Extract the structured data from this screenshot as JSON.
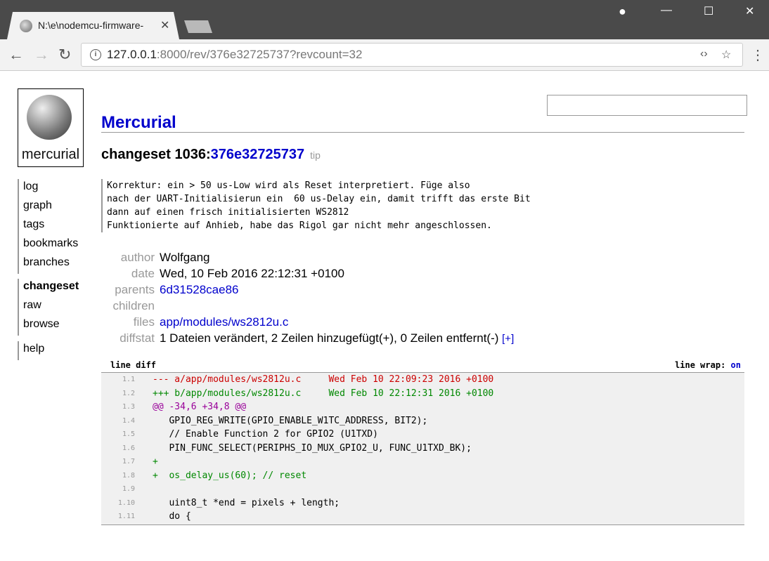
{
  "browser": {
    "tab_title": "N:\\e\\nodemcu-firmware-",
    "url_host": "127.0.0.1",
    "url_rest": ":8000/rev/376e32725737?revcount=32",
    "nav_icons": [
      "back-icon",
      "forward-icon",
      "reload-icon"
    ]
  },
  "page": {
    "logo_text": "mercurial",
    "site_title": "Mercurial",
    "search_placeholder": ""
  },
  "sidebar": {
    "group1": [
      "log",
      "graph",
      "tags",
      "bookmarks",
      "branches"
    ],
    "group2": [
      "changeset",
      "raw",
      "browse"
    ],
    "group3": [
      "help"
    ]
  },
  "changeset": {
    "label": "changeset 1036:",
    "hash": "376e32725737",
    "tag": "tip",
    "description": [
      "Korrektur: ein > 50 us-Low wird als Reset interpretiert. Füge also",
      "nach der UART-Initialisierun ein  60 us-Delay ein, damit trifft das erste Bit",
      "dann auf einen frisch initialisierten WS2812",
      "Funktionierte auf Anhieb, habe das Rigol gar nicht mehr angeschlossen."
    ],
    "meta": {
      "author_label": "author",
      "author": "Wolfgang",
      "date_label": "date",
      "date": "Wed, 10 Feb 2016 22:12:31 +0100",
      "parents_label": "parents",
      "parents": "6d31528cae86",
      "children_label": "children",
      "children": "",
      "files_label": "files",
      "files": "app/modules/ws2812u.c",
      "diffstat_label": "diffstat",
      "diffstat": "1 Dateien verändert, 2 Zeilen hinzugefügt(+), 0 Zeilen entfernt(-)",
      "diffstat_toggle": "[+]"
    }
  },
  "diff": {
    "header_left": "line diff",
    "wrap_label": "line wrap:",
    "wrap_value": "on",
    "lines": [
      {
        "n": "1.1",
        "t": "--- a/app/modules/ws2812u.c     Wed Feb 10 22:09:23 2016 +0100",
        "k": "minus"
      },
      {
        "n": "1.2",
        "t": "+++ b/app/modules/ws2812u.c     Wed Feb 10 22:12:31 2016 +0100",
        "k": "plus"
      },
      {
        "n": "1.3",
        "t": "@@ -34,6 +34,8 @@",
        "k": "atat"
      },
      {
        "n": "1.4",
        "t": "   GPIO_REG_WRITE(GPIO_ENABLE_W1TC_ADDRESS, BIT2);",
        "k": "ctx"
      },
      {
        "n": "1.5",
        "t": "   // Enable Function 2 for GPIO2 (U1TXD)",
        "k": "ctx"
      },
      {
        "n": "1.6",
        "t": "   PIN_FUNC_SELECT(PERIPHS_IO_MUX_GPIO2_U, FUNC_U1TXD_BK);",
        "k": "ctx"
      },
      {
        "n": "1.7",
        "t": "+",
        "k": "plus"
      },
      {
        "n": "1.8",
        "t": "+  os_delay_us(60); // reset",
        "k": "plus"
      },
      {
        "n": "1.9",
        "t": "",
        "k": "ctx"
      },
      {
        "n": "1.10",
        "t": "   uint8_t *end = pixels + length;",
        "k": "ctx"
      },
      {
        "n": "1.11",
        "t": "   do {",
        "k": "ctx"
      }
    ]
  }
}
